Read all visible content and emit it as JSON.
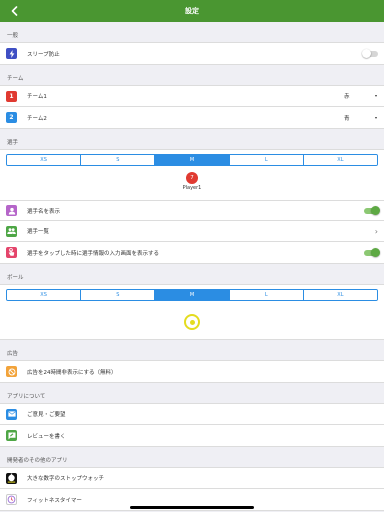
{
  "navbar": {
    "title": "設定",
    "back_icon": "chevron-left-icon"
  },
  "colors": {
    "navbar": "#4a9631",
    "segment_accent": "#2b8de3",
    "toggle_on": "#5da943",
    "team1": "#e03a31",
    "team2": "#2b8de3",
    "ball": "#e4dc1f"
  },
  "general": {
    "header": "一般",
    "sleep": {
      "label": "スリープ防止",
      "icon": "bolt-icon",
      "toggle": "off"
    }
  },
  "team": {
    "header": "チーム",
    "team1": {
      "badge": "1",
      "label": "チーム1",
      "value": "赤"
    },
    "team2": {
      "badge": "2",
      "label": "チーム2",
      "value": "青"
    }
  },
  "player": {
    "header": "選手",
    "sizes": [
      "XS",
      "S",
      "M",
      "L",
      "XL"
    ],
    "selected": "M",
    "preview_number": "7",
    "preview_name": "Player1",
    "show_name": {
      "label": "選手名を表示",
      "icon": "person-icon",
      "toggle": "on"
    },
    "list": {
      "label": "選手一覧",
      "icon": "people-icon"
    },
    "tap_input": {
      "label": "選手をタップした時に選手情報の入力画面を表示する",
      "icon": "tap-hand-icon",
      "toggle": "on"
    }
  },
  "ball": {
    "header": "ボール",
    "sizes": [
      "XS",
      "S",
      "M",
      "L",
      "XL"
    ],
    "selected": "M"
  },
  "ads": {
    "header": "広告",
    "hide": {
      "label": "広告を24時間非表示にする（無料）",
      "icon": "no-ads-icon"
    }
  },
  "about": {
    "header": "アプリについて",
    "feedback": {
      "label": "ご意見・ご要望",
      "icon": "mail-icon"
    },
    "review": {
      "label": "レビューを書く",
      "icon": "review-icon"
    }
  },
  "dev_apps": {
    "header": "開発者のその他のアプリ",
    "stopwatch": {
      "label": "大きな数字のストップウォッチ",
      "icon": "stopwatch-app-icon"
    },
    "fitness": {
      "label": "フィットネスタイマー",
      "icon": "fitness-timer-app-icon"
    }
  }
}
